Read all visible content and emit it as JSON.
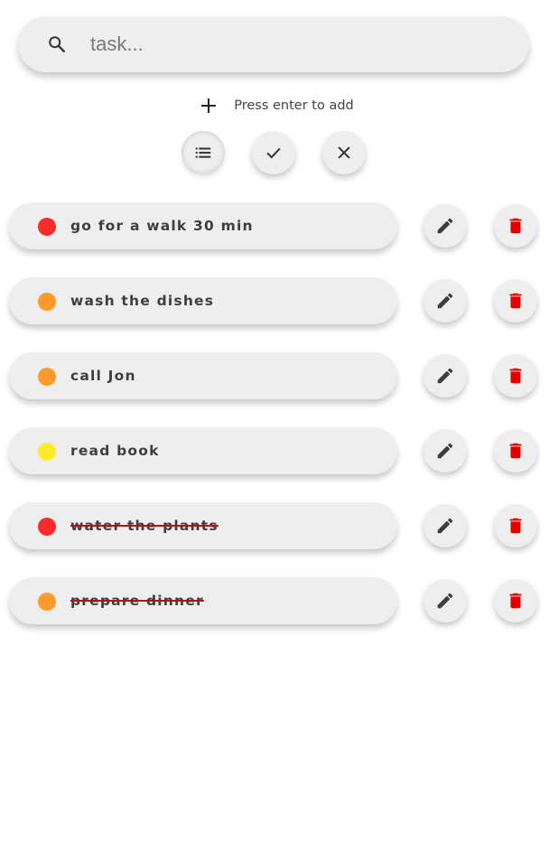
{
  "search": {
    "placeholder": "task...",
    "value": "",
    "icon": "search-icon"
  },
  "add": {
    "icon": "plus-icon",
    "hint": "Press enter to add"
  },
  "filters": [
    {
      "name": "all",
      "icon": "list-icon",
      "active": true
    },
    {
      "name": "completed",
      "icon": "check-icon",
      "active": false
    },
    {
      "name": "uncompleted",
      "icon": "close-icon",
      "active": false
    }
  ],
  "colors": {
    "high": "#ff2b2b",
    "medium": "#ff9a2b",
    "low": "#ffeb2b",
    "delete": "#e00000",
    "edit": "#3c3c3c",
    "strike": "#b0101a"
  },
  "tasks": [
    {
      "text": "go for a walk 30 min",
      "priority": "high",
      "done": false
    },
    {
      "text": "wash the dishes",
      "priority": "medium",
      "done": false
    },
    {
      "text": "call Jon",
      "priority": "medium",
      "done": false
    },
    {
      "text": "read book",
      "priority": "low",
      "done": false
    },
    {
      "text": "water the plants",
      "priority": "high",
      "done": true
    },
    {
      "text": "prepare dinner",
      "priority": "medium",
      "done": true
    }
  ]
}
